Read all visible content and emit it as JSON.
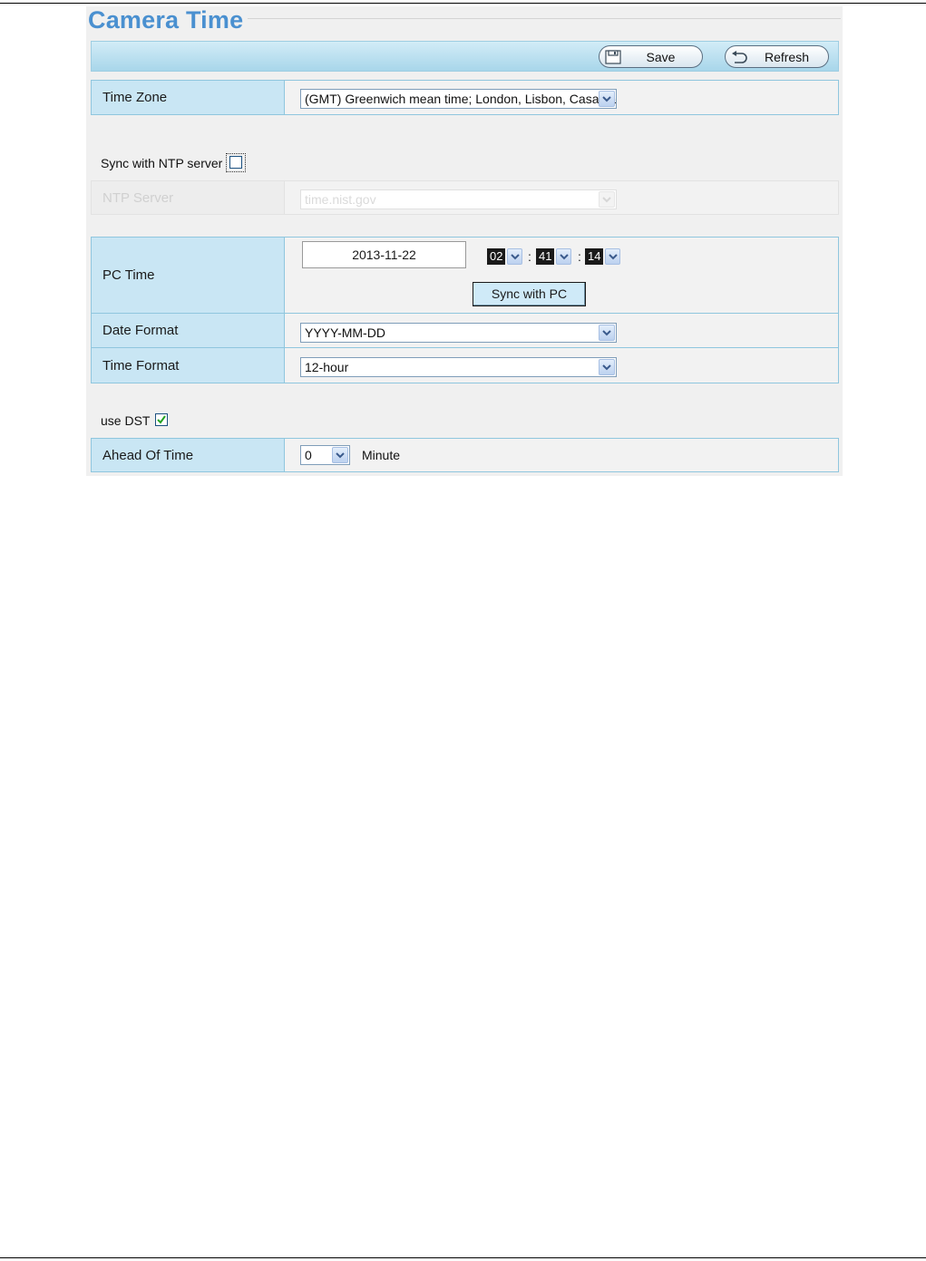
{
  "page": {
    "title": "Camera Time"
  },
  "toolbar": {
    "save_label": "Save",
    "refresh_label": "Refresh"
  },
  "time_zone": {
    "label": "Time Zone",
    "value": "(GMT) Greenwich mean time; London, Lisbon, Casablanca"
  },
  "ntp": {
    "sync_label": "Sync with NTP server",
    "sync_checked": false,
    "server_label": "NTP Server",
    "server_value": "time.nist.gov",
    "disabled": true
  },
  "pc_time": {
    "label": "PC Time",
    "date": "2013-11-22",
    "hour": "02",
    "minute": "41",
    "second": "14",
    "separator": ":",
    "sync_button_label": "Sync with PC"
  },
  "date_format": {
    "label": "Date Format",
    "value": "YYYY-MM-DD"
  },
  "time_format": {
    "label": "Time Format",
    "value": "12-hour"
  },
  "dst": {
    "label": "use DST",
    "checked": true
  },
  "ahead_of_time": {
    "label": "Ahead Of Time",
    "value": "0",
    "unit": "Minute"
  },
  "colors": {
    "title": "#4a90d0",
    "label_cell": "#c9e6f4",
    "border": "#8fc6de",
    "panel_bg": "#f0f0f0"
  }
}
